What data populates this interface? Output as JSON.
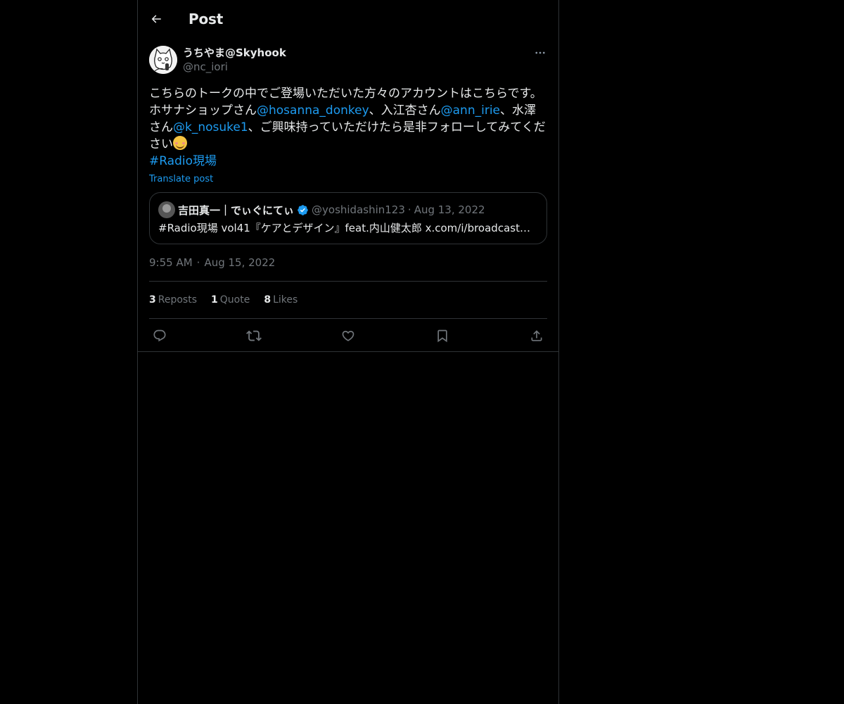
{
  "header": {
    "title": "Post"
  },
  "post": {
    "author": {
      "display_name": "うちやま@Skyhook",
      "handle": "@nc_iori"
    },
    "text": {
      "part1": "こちらのトークの中でご登場いただいた方々のアカウントはこちらです。",
      "part2": "ホサナショップさん",
      "mention1": "@hosanna_donkey",
      "part3": "、入江杏さん",
      "mention2": "@ann_irie",
      "part4": "、水澤さん",
      "mention3": "@k_nosuke1",
      "part5": "、ご興味持っていただけたら是非フォローしてみてください",
      "hashtag": "#Radio現場"
    },
    "translate_label": "Translate post",
    "quote": {
      "display_name": "吉田真一｜でぃぐにてぃ",
      "handle": "@yoshidashin123",
      "date": "Aug 13, 2022",
      "text": "#Radio現場 vol41『ケアとデザイン』feat.内山健太郎 x.com/i/broadcasts/1…"
    },
    "time": "9:55 AM",
    "date": "Aug 15, 2022",
    "stats": {
      "reposts": {
        "count": "3",
        "label": "Reposts"
      },
      "quotes": {
        "count": "1",
        "label": "Quote"
      },
      "likes": {
        "count": "8",
        "label": "Likes"
      }
    }
  },
  "colors": {
    "background": "#000000",
    "text": "#e7e9ea",
    "muted": "#71767b",
    "accent": "#1d9bf0",
    "border": "#2f3336"
  },
  "icons": [
    "back-arrow-icon",
    "more-icon",
    "verified-badge-icon",
    "reply-icon",
    "repost-icon",
    "like-icon",
    "bookmark-icon",
    "share-icon"
  ]
}
